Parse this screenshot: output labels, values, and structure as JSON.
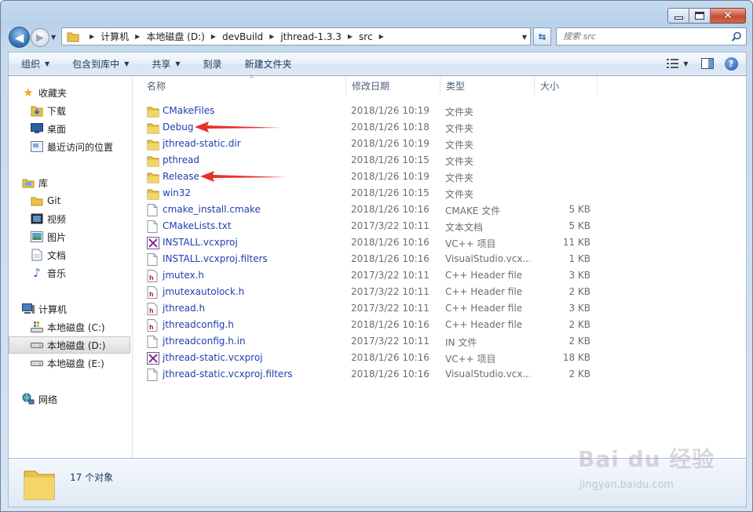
{
  "address": {
    "crumbs": [
      "计算机",
      "本地磁盘 (D:)",
      "devBuild",
      "jthread-1.3.3",
      "src"
    ]
  },
  "search": {
    "placeholder": "搜索 src"
  },
  "toolbar": {
    "organize": "组织",
    "include": "包含到库中",
    "share": "共享",
    "burn": "刻录",
    "new_folder": "新建文件夹"
  },
  "sidebar": {
    "favorites": {
      "label": "收藏夹",
      "items": [
        "下载",
        "桌面",
        "最近访问的位置"
      ]
    },
    "libraries": {
      "label": "库",
      "items": [
        "Git",
        "视频",
        "图片",
        "文档",
        "音乐"
      ]
    },
    "computer": {
      "label": "计算机",
      "items": [
        "本地磁盘 (C:)",
        "本地磁盘 (D:)",
        "本地磁盘 (E:)"
      ]
    },
    "network": {
      "label": "网络"
    }
  },
  "columns": {
    "name": "名称",
    "date": "修改日期",
    "type": "类型",
    "size": "大小"
  },
  "files": [
    {
      "name": "CMakeFiles",
      "date": "2018/1/26 10:19",
      "type": "文件夹",
      "size": "",
      "icon": "folder"
    },
    {
      "name": "Debug",
      "date": "2018/1/26 10:18",
      "type": "文件夹",
      "size": "",
      "icon": "folder"
    },
    {
      "name": "jthread-static.dir",
      "date": "2018/1/26 10:19",
      "type": "文件夹",
      "size": "",
      "icon": "folder"
    },
    {
      "name": "pthread",
      "date": "2018/1/26 10:15",
      "type": "文件夹",
      "size": "",
      "icon": "folder"
    },
    {
      "name": "Release",
      "date": "2018/1/26 10:19",
      "type": "文件夹",
      "size": "",
      "icon": "folder"
    },
    {
      "name": "win32",
      "date": "2018/1/26 10:15",
      "type": "文件夹",
      "size": "",
      "icon": "folder"
    },
    {
      "name": "cmake_install.cmake",
      "date": "2018/1/26 10:16",
      "type": "CMAKE 文件",
      "size": "5 KB",
      "icon": "file"
    },
    {
      "name": "CMakeLists.txt",
      "date": "2017/3/22 10:11",
      "type": "文本文档",
      "size": "5 KB",
      "icon": "file"
    },
    {
      "name": "INSTALL.vcxproj",
      "date": "2018/1/26 10:16",
      "type": "VC++ 项目",
      "size": "11 KB",
      "icon": "vcxproj"
    },
    {
      "name": "INSTALL.vcxproj.filters",
      "date": "2018/1/26 10:16",
      "type": "VisualStudio.vcx...",
      "size": "1 KB",
      "icon": "file"
    },
    {
      "name": "jmutex.h",
      "date": "2017/3/22 10:11",
      "type": "C++ Header file",
      "size": "3 KB",
      "icon": "header"
    },
    {
      "name": "jmutexautolock.h",
      "date": "2017/3/22 10:11",
      "type": "C++ Header file",
      "size": "2 KB",
      "icon": "header"
    },
    {
      "name": "jthread.h",
      "date": "2017/3/22 10:11",
      "type": "C++ Header file",
      "size": "3 KB",
      "icon": "header"
    },
    {
      "name": "jthreadconfig.h",
      "date": "2018/1/26 10:16",
      "type": "C++ Header file",
      "size": "2 KB",
      "icon": "header"
    },
    {
      "name": "jthreadconfig.h.in",
      "date": "2017/3/22 10:11",
      "type": "IN 文件",
      "size": "2 KB",
      "icon": "file"
    },
    {
      "name": "jthread-static.vcxproj",
      "date": "2018/1/26 10:16",
      "type": "VC++ 项目",
      "size": "18 KB",
      "icon": "vcxproj"
    },
    {
      "name": "jthread-static.vcxproj.filters",
      "date": "2018/1/26 10:16",
      "type": "VisualStudio.vcx...",
      "size": "2 KB",
      "icon": "file"
    }
  ],
  "status": {
    "count": "17 个对象"
  },
  "watermark": {
    "text": "Bai du 经验",
    "url": "jingyan.baidu.com"
  },
  "colors": {
    "link": "#1f3fb0",
    "annotation_arrow": "#e8302a",
    "folder": "#e9c24a"
  }
}
